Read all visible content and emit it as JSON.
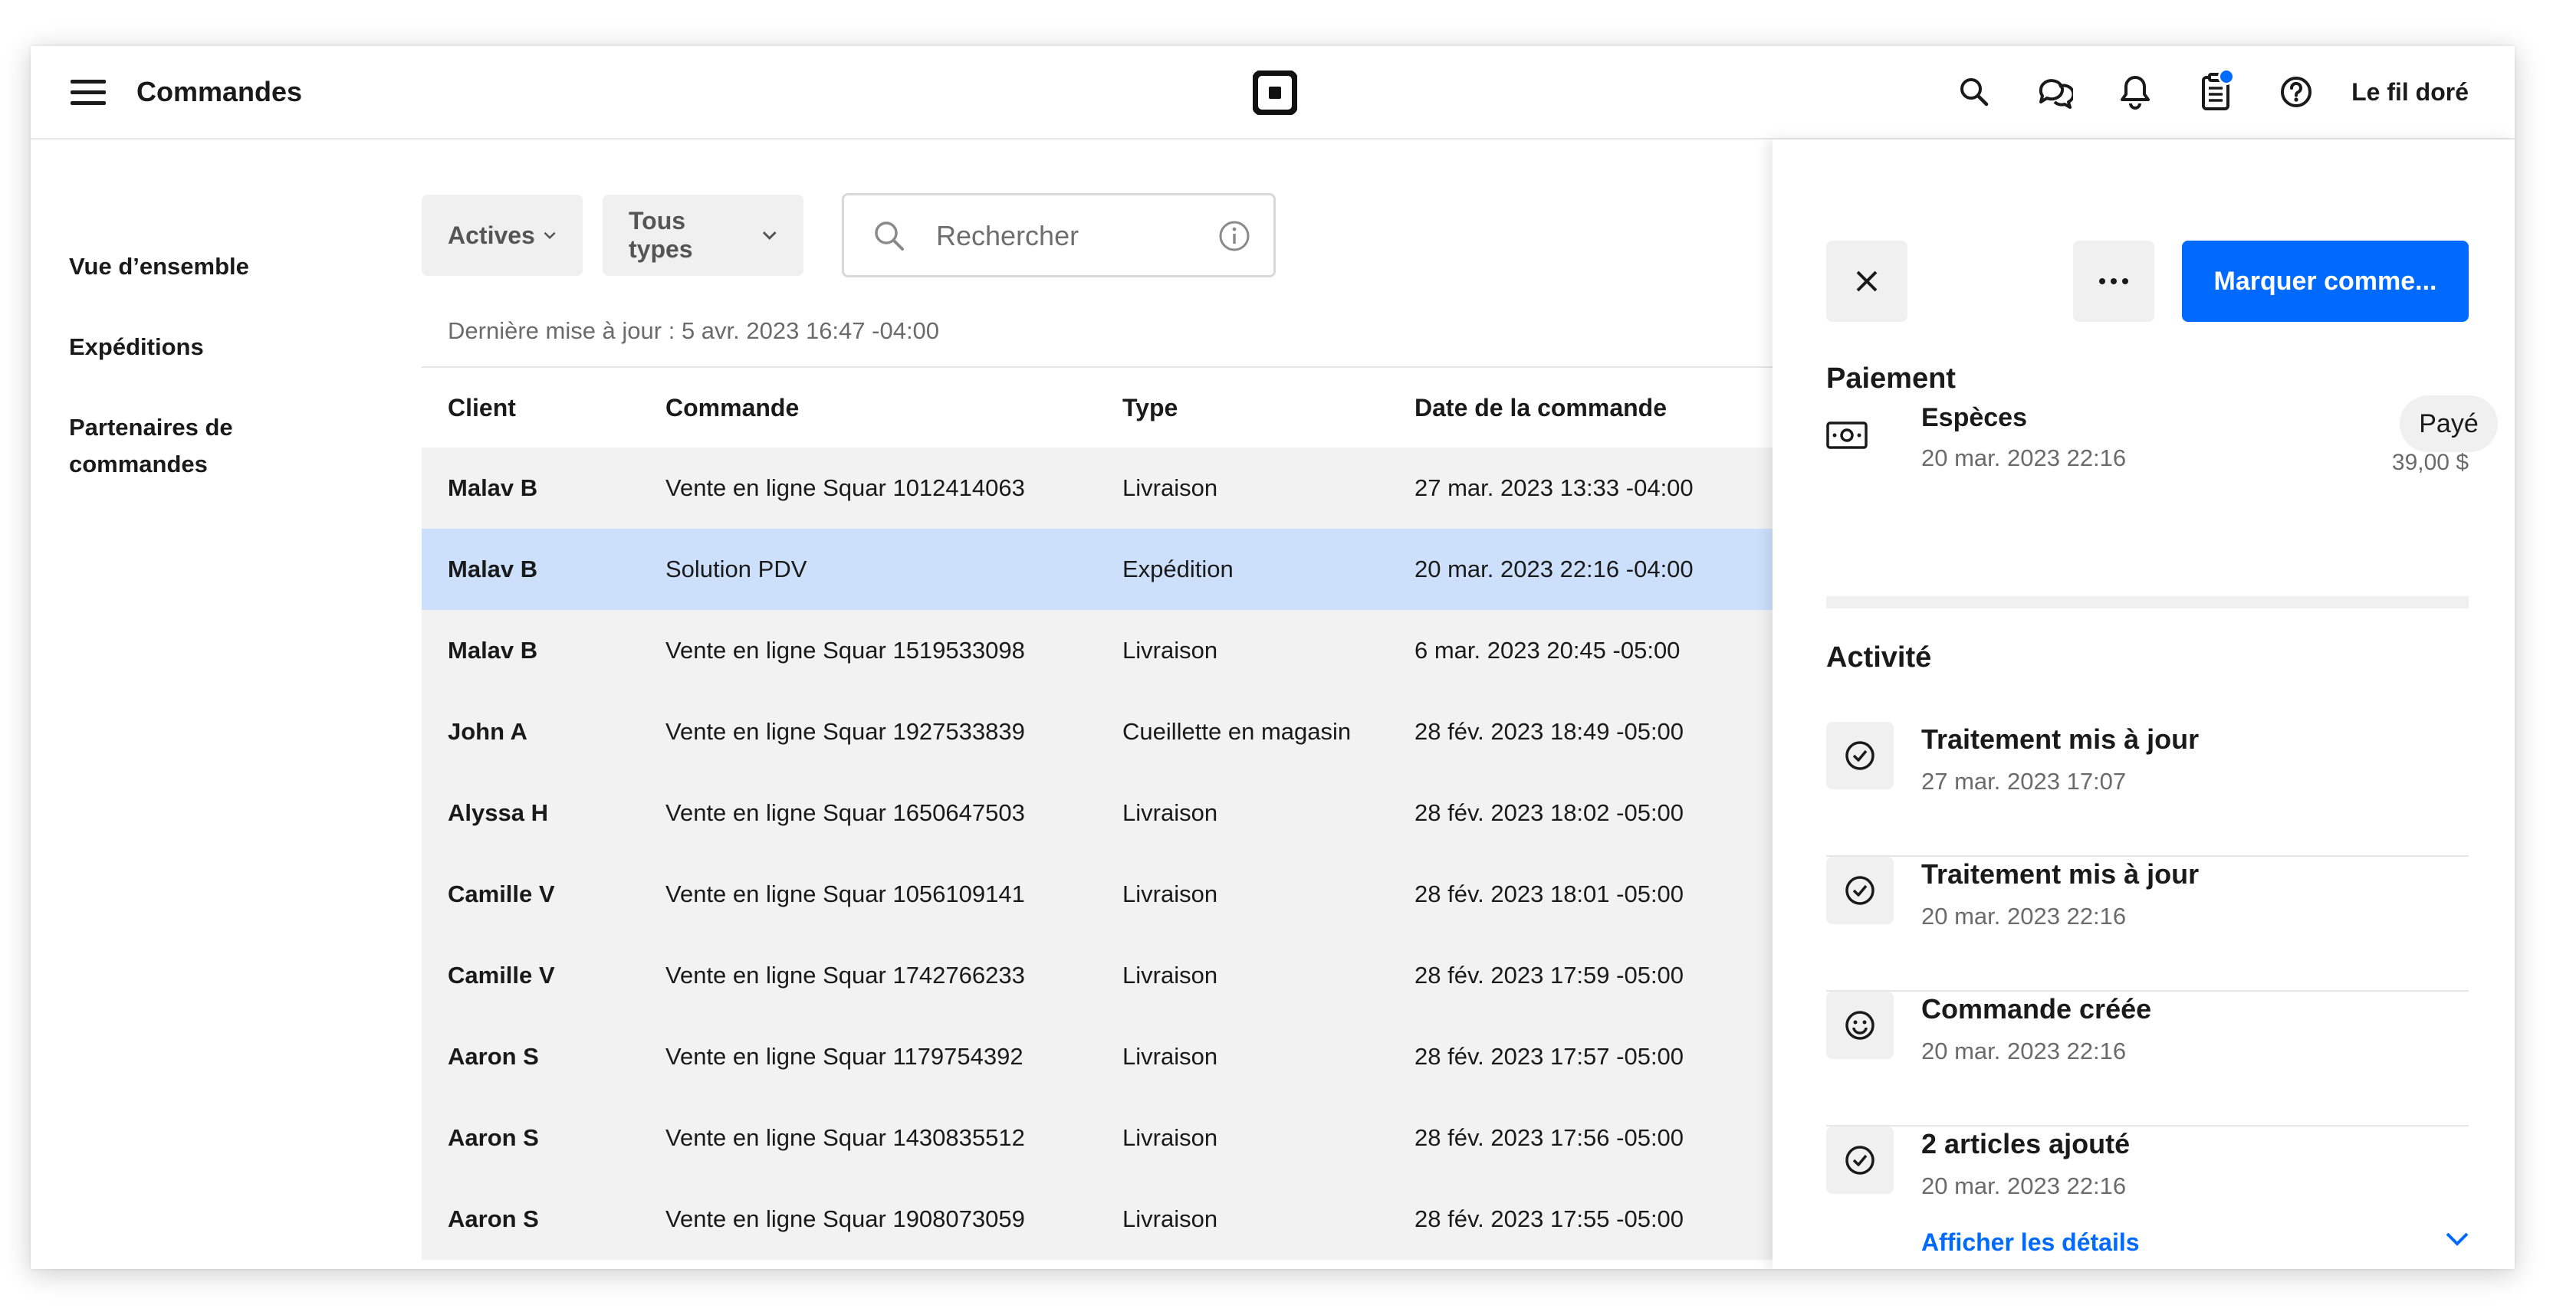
{
  "header": {
    "menu_icon": "hamburger-menu-icon",
    "title": "Commandes",
    "logo_icon": "square-logo-icon",
    "icons": [
      "search-icon",
      "messages-icon",
      "bell-icon",
      "clipboard-icon",
      "help-icon"
    ],
    "store_name": "Le fil doré"
  },
  "sidebar": {
    "items": [
      {
        "label": "Vue d’ensemble"
      },
      {
        "label": "Expéditions"
      },
      {
        "label": "Partenaires de commandes"
      }
    ]
  },
  "filters": {
    "status_label": "Actives",
    "type_label": "Tous types",
    "search_placeholder": "Rechercher",
    "last_update": "Dernière mise à jour : 5 avr. 2023 16:47 -04:00"
  },
  "table": {
    "columns": [
      "Client",
      "Commande",
      "Type",
      "Date de la commande"
    ],
    "rows": [
      {
        "client": "Malav B",
        "order": "Vente en ligne Squar 1012414063",
        "type": "Livraison",
        "date": "27 mar. 2023 13:33 -04:00"
      },
      {
        "client": "Malav B",
        "order": "Solution PDV",
        "type": "Expédition",
        "date": "20 mar. 2023 22:16 -04:00",
        "selected": true
      },
      {
        "client": "Malav B",
        "order": "Vente en ligne Squar 1519533098",
        "type": "Livraison",
        "date": "6 mar. 2023 20:45 -05:00"
      },
      {
        "client": "John A",
        "order": "Vente en ligne Squar 1927533839",
        "type": "Cueillette en magasin",
        "date": "28 fév. 2023 18:49 -05:00"
      },
      {
        "client": "Alyssa H",
        "order": "Vente en ligne Squar 1650647503",
        "type": "Livraison",
        "date": "28 fév. 2023 18:02 -05:00"
      },
      {
        "client": "Camille V",
        "order": "Vente en ligne Squar 1056109141",
        "type": "Livraison",
        "date": "28 fév. 2023 18:01 -05:00"
      },
      {
        "client": "Camille V",
        "order": "Vente en ligne Squar 1742766233",
        "type": "Livraison",
        "date": "28 fév. 2023 17:59 -05:00"
      },
      {
        "client": "Aaron S",
        "order": "Vente en ligne Squar 1179754392",
        "type": "Livraison",
        "date": "28 fév. 2023 17:57 -05:00"
      },
      {
        "client": "Aaron S",
        "order": "Vente en ligne Squar 1430835512",
        "type": "Livraison",
        "date": "28 fév. 2023 17:56 -05:00"
      },
      {
        "client": "Aaron S",
        "order": "Vente en ligne Squar 1908073059",
        "type": "Livraison",
        "date": "28 fév. 2023 17:55 -05:00"
      }
    ]
  },
  "panel": {
    "primary_button": "Marquer comme...",
    "payment_title": "Paiement",
    "payment": {
      "method": "Espèces",
      "date": "20 mar. 2023 22:16",
      "status": "Payé",
      "amount": "39,00 $",
      "icon": "cash-icon"
    },
    "activity_title": "Activité",
    "activity": [
      {
        "title": "Traitement mis à jour",
        "date": "27 mar. 2023 17:07",
        "icon": "check-circle-icon"
      },
      {
        "title": "Traitement mis à jour",
        "date": "20 mar. 2023 22:16",
        "icon": "check-circle-icon"
      },
      {
        "title": "Commande créée",
        "date": "20 mar. 2023 22:16",
        "icon": "smiley-icon"
      },
      {
        "title": "2 articles ajouté",
        "date": "20 mar. 2023 22:16",
        "icon": "check-circle-icon"
      }
    ],
    "details_link": "Afficher les détails"
  },
  "colors": {
    "accent": "#006aff",
    "selected_row": "#cce0fc",
    "row_bg": "#f2f2f2",
    "chip_bg": "#f0f0f0"
  }
}
